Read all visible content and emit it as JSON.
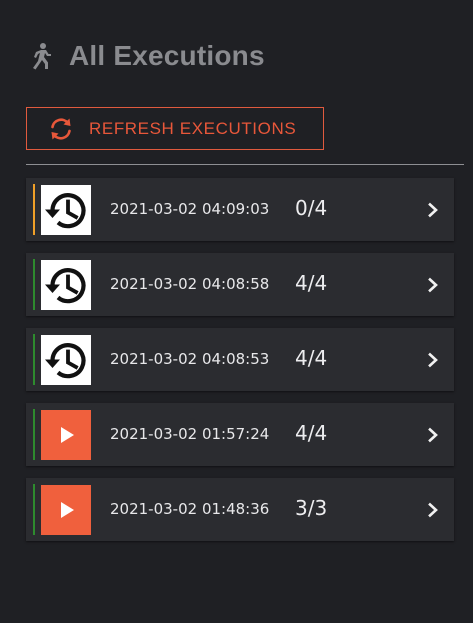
{
  "header": {
    "title": "All Executions",
    "icon": "run-icon"
  },
  "toolbar": {
    "refresh_label": "REFRESH EXECUTIONS",
    "refresh_icon": "refresh-icon"
  },
  "colors": {
    "background": "#1f2024",
    "card": "#2b2c30",
    "accent": "#e8573a",
    "status_pending": "#f0a028",
    "status_done": "#2e8b2e",
    "play_tile": "#f0603d"
  },
  "executions": [
    {
      "timestamp": "2021-03-02 04:09:03",
      "count": "0/4",
      "status": "pending",
      "icon": "history-icon"
    },
    {
      "timestamp": "2021-03-02 04:08:58",
      "count": "4/4",
      "status": "done",
      "icon": "history-icon"
    },
    {
      "timestamp": "2021-03-02 04:08:53",
      "count": "4/4",
      "status": "done",
      "icon": "history-icon"
    },
    {
      "timestamp": "2021-03-02 01:57:24",
      "count": "4/4",
      "status": "done",
      "icon": "play-icon"
    },
    {
      "timestamp": "2021-03-02 01:48:36",
      "count": "3/3",
      "status": "done",
      "icon": "play-icon"
    }
  ]
}
